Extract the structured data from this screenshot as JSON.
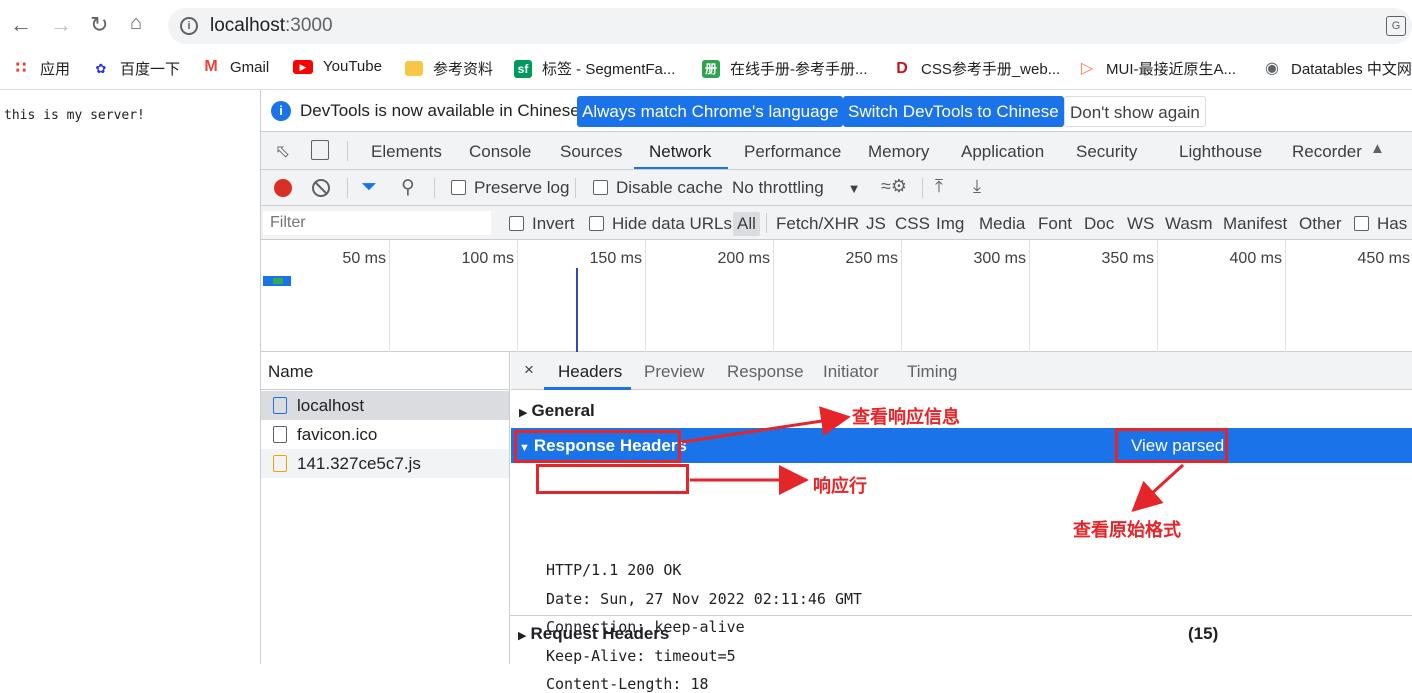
{
  "browser": {
    "url_host": "localhost",
    "url_port": ":3000",
    "nav_icons": [
      "back-icon",
      "forward-icon",
      "reload-icon",
      "home-icon"
    ],
    "bookmarks": [
      {
        "label": "应用",
        "icon": "apps-grid-icon"
      },
      {
        "label": "百度一下",
        "icon": "baidu-paw-icon"
      },
      {
        "label": "Gmail",
        "icon": "gmail-icon"
      },
      {
        "label": "YouTube",
        "icon": "youtube-icon"
      },
      {
        "label": "参考资料",
        "icon": "folder-icon"
      },
      {
        "label": "标签 - SegmentFa...",
        "icon": "segmentfault-icon"
      },
      {
        "label": "在线手册-参考手册...",
        "icon": "manual-icon"
      },
      {
        "label": "CSS参考手册_web...",
        "icon": "css-manual-icon"
      },
      {
        "label": "MUI-最接近原生A...",
        "icon": "mui-icon"
      },
      {
        "label": "Datatables 中文网",
        "icon": "globe-icon"
      }
    ]
  },
  "page": {
    "text": "this is my server!"
  },
  "devtools": {
    "infobar": {
      "message": "DevTools is now available in Chinese!",
      "btn_match": "Always match Chrome's language",
      "btn_switch": "Switch DevTools to Chinese",
      "btn_dismiss": "Don't show again"
    },
    "tabs": [
      "Elements",
      "Console",
      "Sources",
      "Network",
      "Performance",
      "Memory",
      "Application",
      "Security",
      "Lighthouse",
      "Recorder"
    ],
    "active_tab": "Network",
    "toolbar": {
      "preserve_log": "Preserve log",
      "disable_cache": "Disable cache",
      "throttling": "No throttling"
    },
    "filter": {
      "placeholder": "Filter",
      "invert": "Invert",
      "hide_data_urls": "Hide data URLs",
      "types": [
        "All",
        "Fetch/XHR",
        "JS",
        "CSS",
        "Img",
        "Media",
        "Font",
        "Doc",
        "WS",
        "Wasm",
        "Manifest",
        "Other"
      ],
      "has_blocked": "Has"
    },
    "timeline": {
      "ticks": [
        "50 ms",
        "100 ms",
        "150 ms",
        "200 ms",
        "250 ms",
        "300 ms",
        "350 ms",
        "400 ms",
        "450 ms"
      ]
    },
    "requests": {
      "column": "Name",
      "items": [
        {
          "name": "localhost",
          "type": "document",
          "selected": true
        },
        {
          "name": "favicon.ico",
          "type": "other",
          "selected": false
        },
        {
          "name": "141.327ce5c7.js",
          "type": "script",
          "selected": false
        }
      ]
    },
    "details": {
      "close": "×",
      "tabs": [
        "Headers",
        "Preview",
        "Response",
        "Initiator",
        "Timing"
      ],
      "active_tab": "Headers",
      "general": "General",
      "response_headers": "Response Headers",
      "view_parsed": "View parsed",
      "raw_headers": [
        "HTTP/1.1 200 OK",
        "Date: Sun, 27 Nov 2022 02:11:46 GMT",
        "Connection: keep-alive",
        "Keep-Alive: timeout=5",
        "Content-Length: 18"
      ],
      "request_headers": "Request Headers",
      "request_headers_count": "(15)"
    }
  },
  "annotations": {
    "view_response_info": "查看响应信息",
    "response_line": "响应行",
    "view_raw_format": "查看原始格式",
    "color": "#e5252a"
  }
}
